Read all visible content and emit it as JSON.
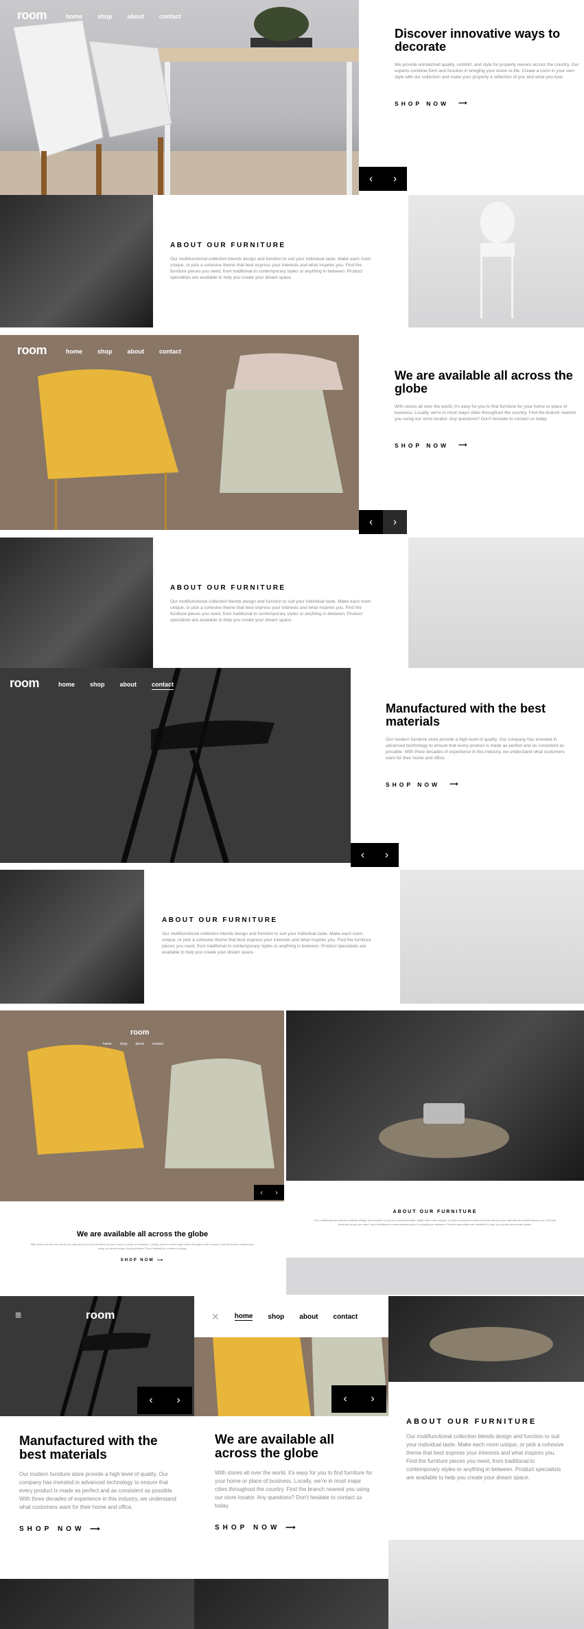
{
  "nav": {
    "logo": "room",
    "home": "home",
    "shop": "shop",
    "about": "about",
    "contact": "contact"
  },
  "slides": [
    {
      "title": "Discover innovative ways to decorate",
      "body": "We provide unmatched quality, comfort, and style for property owners across the country. Our experts combine form and function in bringing your vision to life. Create a room in your own style with our collection and make your property a reflection of you and what you love.",
      "cta": "SHOP NOW"
    },
    {
      "title": "We are available all across the globe",
      "body": "With stores all over the world, it's easy for you to find furniture for your home or place of business. Locally, we're in most major cities throughout the country. Find the branch nearest you using our store locator. Any questions? Don't hesitate to contact us today.",
      "cta": "SHOP NOW"
    },
    {
      "title": "Manufactured with the best materials",
      "body": "Our modern furniture store provide a high level of quality. Our company has invested in advanced technology to ensure that every product is made as perfect and as consistent as possible. With three decades of experience in this industry, we understand what customers want for their home and office.",
      "cta": "SHOP NOW"
    }
  ],
  "about": {
    "title": "ABOUT OUR FURNITURE",
    "body": "Our multifunctional collection blends design and function to suit your individual taste. Make each room unique, or pick a cohesive theme that best express your interests and what inspires you. Find the furniture pieces you need, from traditional to contemporary styles or anything in between. Product specialists are available to help you create your dream space."
  },
  "icons": {
    "prev": "angle-left-icon",
    "next": "angle-right-icon",
    "arrow": "long-arrow-icon",
    "menu": "hamburger-icon",
    "close": "close-icon"
  }
}
